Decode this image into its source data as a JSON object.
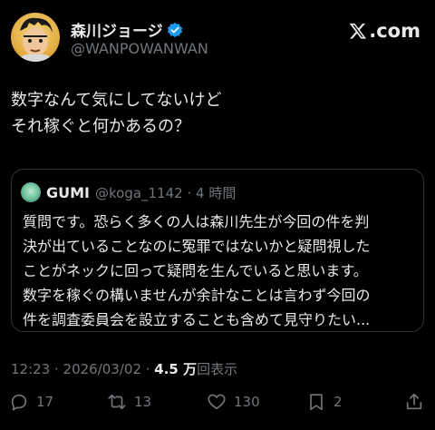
{
  "author": {
    "display_name": "森川ジョージ",
    "handle": "@WANPOWANWAN",
    "verified_icon": "verified-badge-icon",
    "avatar_icon": "cartoon-avatar"
  },
  "brand": {
    "label": ".com",
    "icon": "x-logo-icon"
  },
  "post": {
    "lines": [
      "数字なんて気にしてないけど",
      "それ稼ぐと何かあるの？"
    ]
  },
  "quote": {
    "name": "GUMI",
    "meta": "@koga_1142 · 4 時間",
    "lines": [
      "質問です。恐らく多くの人は森川先生が今回の件を判",
      "決が出ていることなのに冤罪ではないかと疑問視した",
      "ことがネックに回って疑問を生んでいると思います。",
      "数字を稼ぐの構いませんが余計なことは言わず今回の",
      "件を調査委員会を設立することも含めて見守りたい..."
    ]
  },
  "timestamp": {
    "time": "12:23 · 2026/03/02 · ",
    "views_value": "4.5 万",
    "views_label": "回表示"
  },
  "actions": {
    "replies": "17",
    "reposts": "13",
    "likes": "130",
    "bookmarks": "2"
  },
  "colors": {
    "background": "#000000",
    "text": "#e7e9ea",
    "muted": "#71767b",
    "verified": "#1d9bf0",
    "border": "#2f3336"
  }
}
